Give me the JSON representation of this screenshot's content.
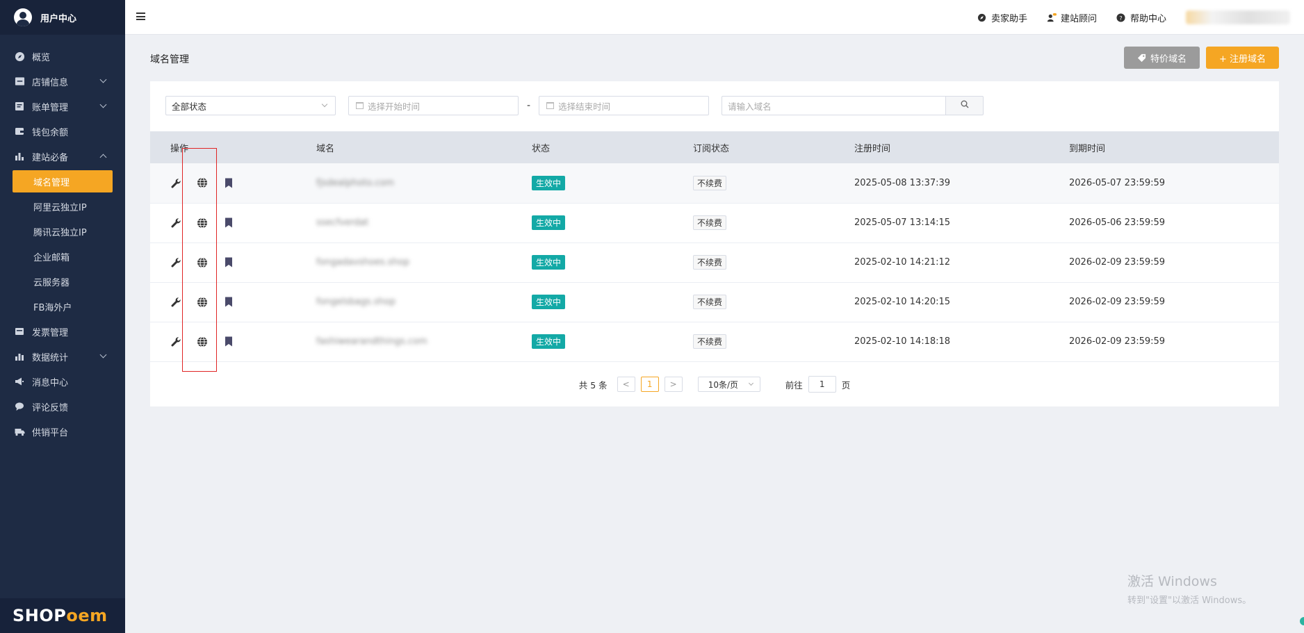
{
  "sidebar": {
    "title": "用户中心",
    "items": [
      {
        "label": "概览",
        "icon": "compass-icon"
      },
      {
        "label": "店铺信息",
        "icon": "store-icon",
        "expandable": true
      },
      {
        "label": "账单管理",
        "icon": "bill-icon",
        "expandable": true
      },
      {
        "label": "钱包余额",
        "icon": "wallet-icon"
      },
      {
        "label": "建站必备",
        "icon": "bar-chart-icon",
        "expanded": true
      }
    ],
    "subitems": [
      "域名管理",
      "阿里云独立IP",
      "腾讯云独立IP",
      "企业邮箱",
      "云服务器",
      "FB海外户"
    ],
    "items2": [
      {
        "label": "发票管理",
        "icon": "invoice-icon"
      },
      {
        "label": "数据统计",
        "icon": "stats-icon",
        "expandable": true
      },
      {
        "label": "消息中心",
        "icon": "megaphone-icon"
      },
      {
        "label": "评论反馈",
        "icon": "chat-icon"
      },
      {
        "label": "供销平台",
        "icon": "truck-icon"
      }
    ],
    "logo": {
      "part1": "SHOP",
      "part2": "oem"
    }
  },
  "topbar": {
    "links": [
      "卖家助手",
      "建站顾问",
      "帮助中心"
    ]
  },
  "page": {
    "title": "域名管理",
    "btn_special": "特价域名",
    "btn_register": "+ 注册域名"
  },
  "filters": {
    "status": "全部状态",
    "start_placeholder": "选择开始时间",
    "dash": "-",
    "end_placeholder": "选择结束时间",
    "search_placeholder": "请输入域名"
  },
  "table": {
    "headers": [
      "操作",
      "域名",
      "状态",
      "订阅状态",
      "注册时间",
      "到期时间"
    ],
    "rows": [
      {
        "domain": "fjsdealphoto.com",
        "status": "生效中",
        "sub": "不续费",
        "reg": "2025-05-08 13:37:39",
        "exp": "2026-05-07 23:59:59"
      },
      {
        "domain": "ssecfverdat",
        "status": "生效中",
        "sub": "不续费",
        "reg": "2025-05-07 13:14:15",
        "exp": "2026-05-06 23:59:59"
      },
      {
        "domain": "fongadavshoes.shop",
        "status": "生效中",
        "sub": "不续费",
        "reg": "2025-02-10 14:21:12",
        "exp": "2026-02-09 23:59:59"
      },
      {
        "domain": "fongelsbags.shop",
        "status": "生效中",
        "sub": "不续费",
        "reg": "2025-02-10 14:20:15",
        "exp": "2026-02-09 23:59:59"
      },
      {
        "domain": "fashiwearandthings.com",
        "status": "生效中",
        "sub": "不续费",
        "reg": "2025-02-10 14:18:18",
        "exp": "2026-02-09 23:59:59"
      }
    ]
  },
  "pager": {
    "total": "共 5 条",
    "prev": "<",
    "current": "1",
    "next": ">",
    "page_size": "10条/页",
    "goto_label": "前往",
    "goto_value": "1",
    "page_unit": "页"
  },
  "watermark": {
    "line1": "激活 Windows",
    "line2": "转到\"设置\"以激活 Windows。"
  },
  "colors": {
    "accent": "#f5a623",
    "sidebar": "#1e2b44",
    "active_tag": "#13a9a6"
  }
}
